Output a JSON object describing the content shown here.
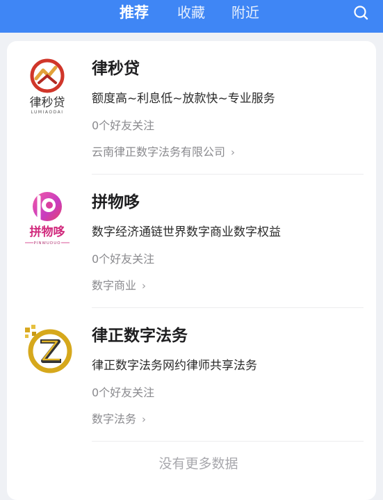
{
  "header": {
    "tabs": [
      {
        "label": "推荐",
        "active": true
      },
      {
        "label": "收藏",
        "active": false
      },
      {
        "label": "附近",
        "active": false
      }
    ],
    "search_icon": "search-icon",
    "background_color": "#3f86f5"
  },
  "list": {
    "items": [
      {
        "name": "律秒贷",
        "description": "额度高~利息低~放款快~专业服务",
        "friends": "0个好友关注",
        "company": "云南律正数字法务有限公司",
        "logo_text": "律秒贷",
        "logo_subtext": "LUMIAODAI",
        "logo_icon": "lumiaodai-logo"
      },
      {
        "name": "拼物哆",
        "description": "数字经济通链世界数字商业数字权益",
        "friends": "0个好友关注",
        "company": "数字商业",
        "logo_text": "拼物哆",
        "logo_subtext": "PINWUDUO",
        "logo_icon": "pinwuduo-logo"
      },
      {
        "name": "律正数字法务",
        "description": "律正数字法务网约律师共享法务",
        "friends": "0个好友关注",
        "company": "数字法务",
        "logo_icon": "lvzheng-logo"
      }
    ],
    "chevron": "›",
    "end_text": "没有更多数据"
  }
}
